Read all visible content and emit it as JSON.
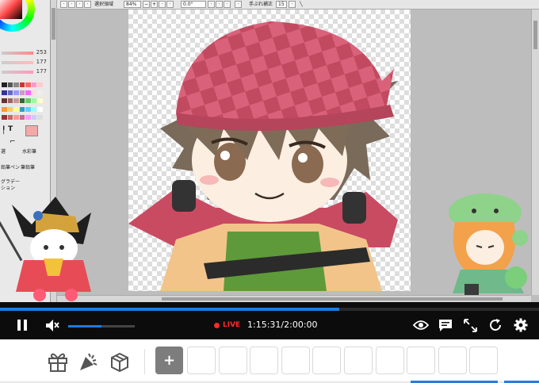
{
  "app": {
    "toolbar": {
      "selection_label": "選択領域",
      "zoom_value": "84%",
      "rotation_value": "0.0°",
      "stabilizer_label": "手ぶれ補正",
      "stabilizer_value": "15"
    },
    "left_panel": {
      "slider_values": [
        "253",
        "177",
        "177"
      ],
      "text_tool_glyph": "T",
      "labels": [
        "選",
        "水彩筆",
        "鉛筆ペン",
        "筆鉛筆",
        "グラデー",
        "ション"
      ]
    }
  },
  "player": {
    "live_label": "LIVE",
    "time_display": "1:15:31/2:00:00",
    "progress_fraction": 0.63,
    "volume_fraction": 0.5,
    "muted": true
  },
  "gift_bar": {
    "add_label": "+",
    "empty_slot_count": 10
  },
  "colors": {
    "progress": "#1e7be0",
    "live": "#ff2a2a",
    "player_bg": "#0c0c0c"
  },
  "icons": [
    "play-pause-icon",
    "mute-icon",
    "eye-icon",
    "comment-icon",
    "fullscreen-icon",
    "reload-icon",
    "settings-icon",
    "gift-icon",
    "celebrate-icon",
    "gift-box-icon"
  ]
}
